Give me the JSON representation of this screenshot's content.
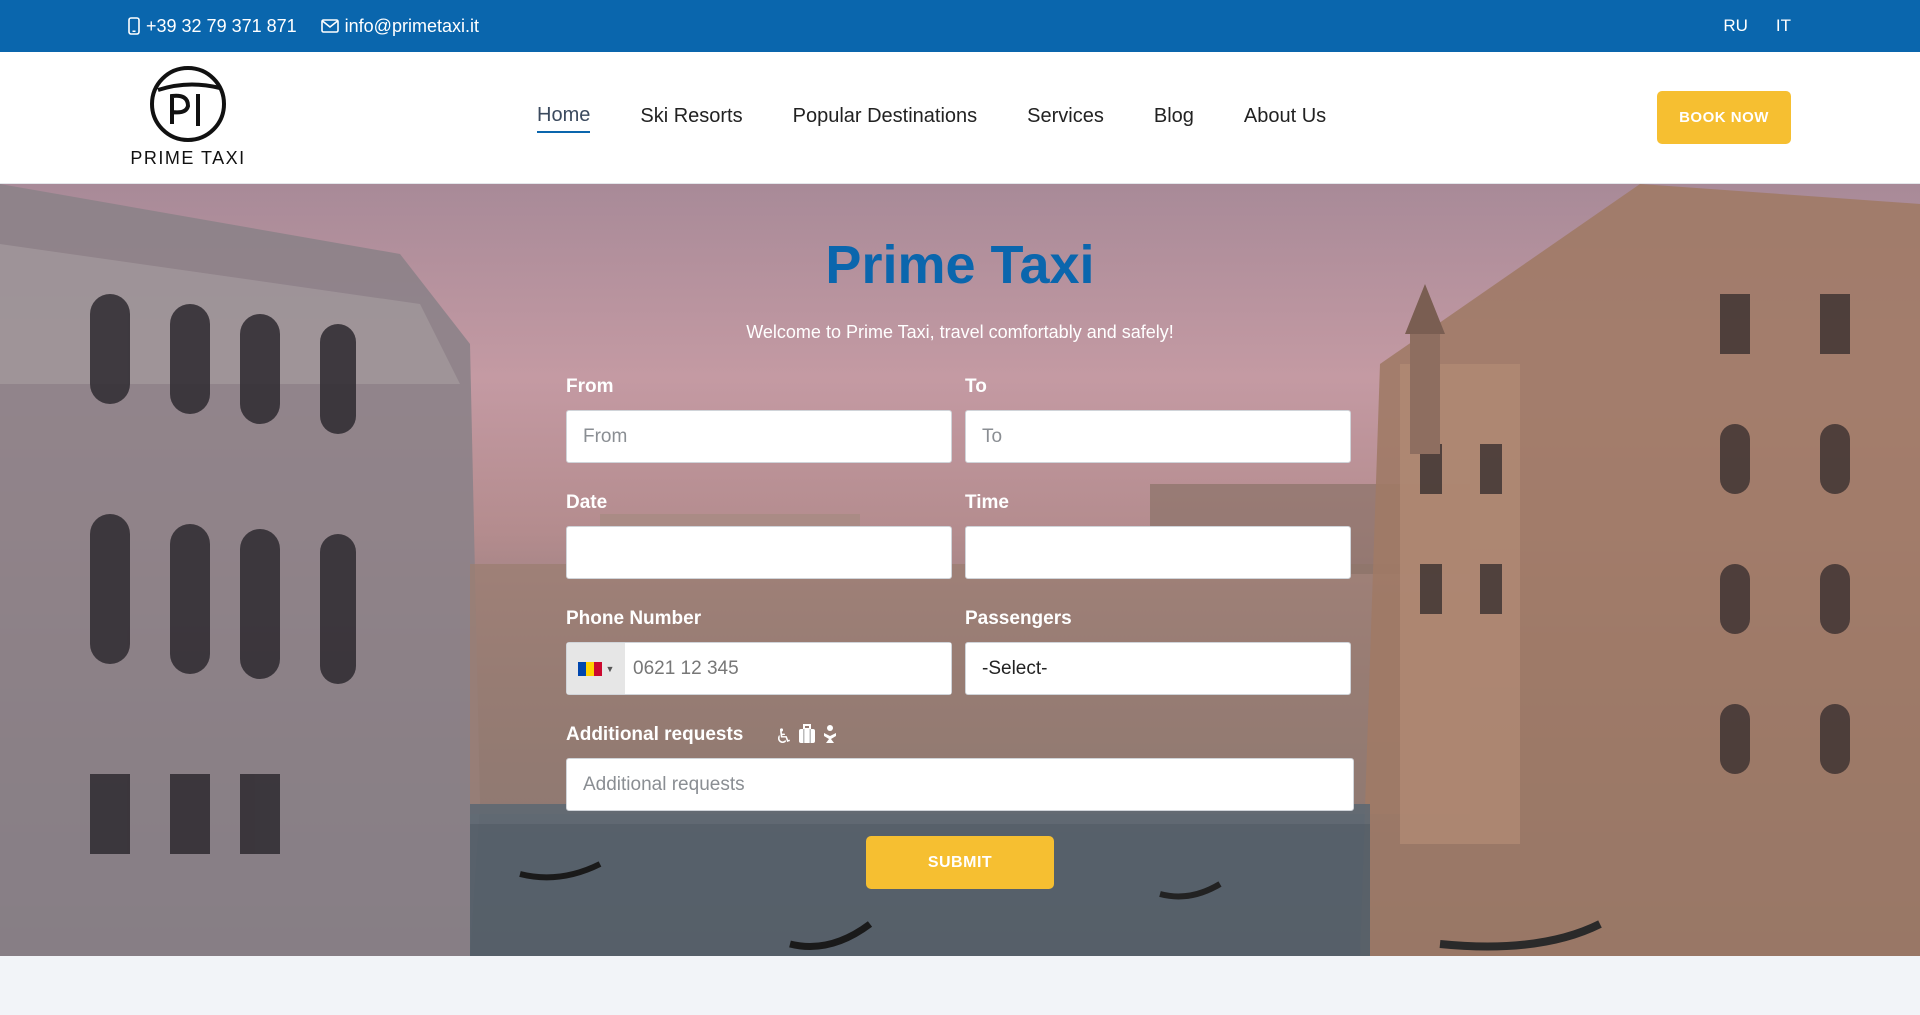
{
  "topbar": {
    "phone": "+39 32 79 371 871",
    "email": "info@primetaxi.it",
    "langs": [
      "RU",
      "IT"
    ]
  },
  "header": {
    "logo_text": "PRIME TAXI",
    "nav": [
      {
        "label": "Home",
        "active": true
      },
      {
        "label": "Ski Resorts"
      },
      {
        "label": "Popular Destinations"
      },
      {
        "label": "Services"
      },
      {
        "label": "Blog"
      },
      {
        "label": "About Us"
      }
    ],
    "book_label": "BOOK NOW"
  },
  "hero": {
    "title": "Prime Taxi",
    "subtitle": "Welcome to Prime Taxi, travel comfortably and safely!"
  },
  "form": {
    "from_label": "From",
    "from_placeholder": "From",
    "to_label": "To",
    "to_placeholder": "To",
    "date_label": "Date",
    "time_label": "Time",
    "phone_label": "Phone Number",
    "phone_placeholder": "0621 12 345",
    "passengers_label": "Passengers",
    "passengers_selected": "-Select-",
    "requests_label": "Additional requests",
    "requests_placeholder": "Additional requests",
    "submit_label": "SUBMIT"
  },
  "colors": {
    "brand_blue": "#0a66ad",
    "accent_yellow": "#f6bf31"
  }
}
